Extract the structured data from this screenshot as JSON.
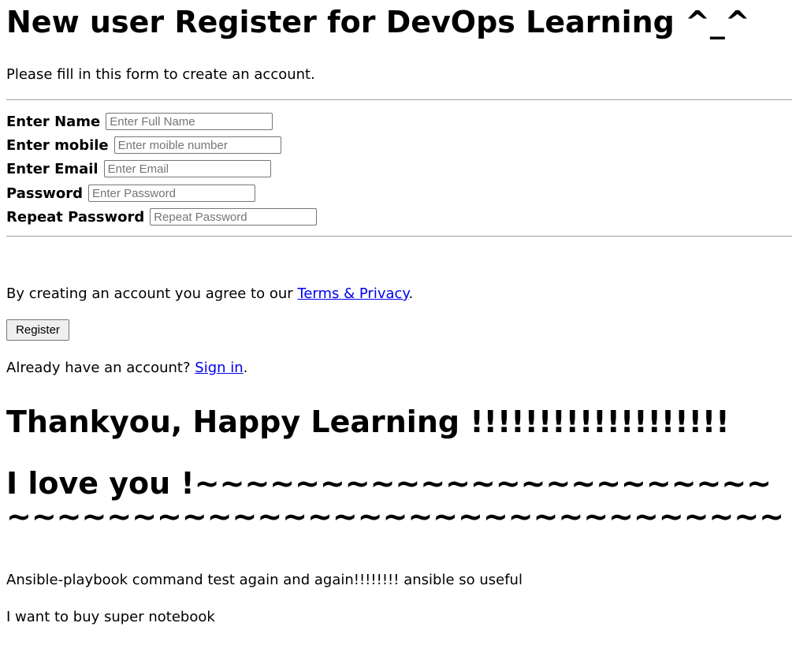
{
  "page": {
    "title": "New user Register for DevOps Learning ^_^",
    "intro": "Please fill in this form to create an account."
  },
  "form": {
    "fields": [
      {
        "label": "Enter Name",
        "value": "",
        "placeholder": "Enter Full Name"
      },
      {
        "label": "Enter mobile",
        "value": "",
        "placeholder": "Enter moible number"
      },
      {
        "label": "Enter Email",
        "value": "",
        "placeholder": "Enter Email"
      },
      {
        "label": "Password",
        "value": "",
        "placeholder": "Enter Password"
      },
      {
        "label": "Repeat Password",
        "value": "",
        "placeholder": "Repeat Password"
      }
    ],
    "agree_text": "By creating an account you agree to our ",
    "terms_link": "Terms & Privacy",
    "agree_end": ".",
    "register_label": "Register",
    "signin_text": "Already have an account? ",
    "signin_link": "Sign in",
    "signin_end": "."
  },
  "footer": {
    "thanks": "Thankyou, Happy Learning !!!!!!!!!!!!!!!!!!!",
    "love": "I love you !~~~~~~~~~~~~~~~~~~~~~~~~~~~~~~~~~~~~~~~~~~~~~~~~~~~~~~~~~~~~~~~~~~~~~~~~~~~~~~~~~~~~~~~~~~~",
    "ansible_note": "Ansible-playbook command test again and again!!!!!!!! ansible so useful",
    "notebook_note": "I want to buy super notebook"
  },
  "colors": {
    "link": "#0000ee",
    "rule": "#a0a0a0",
    "button_bg": "#efefef"
  }
}
